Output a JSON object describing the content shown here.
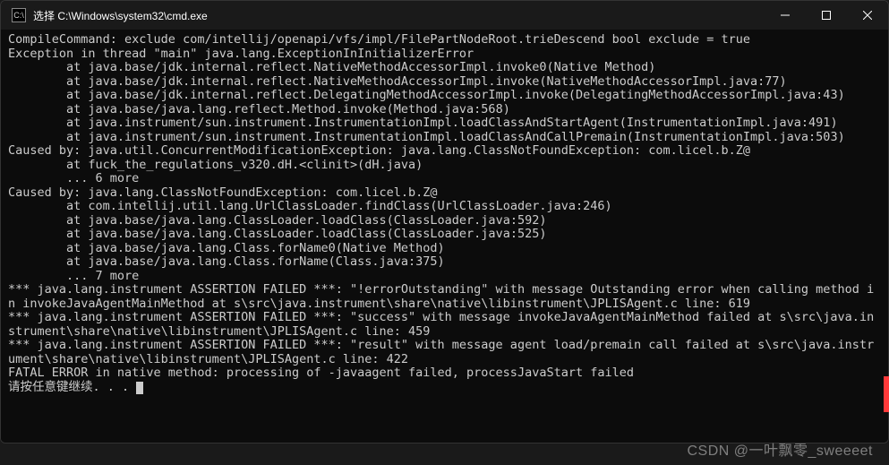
{
  "window": {
    "title": "选择 C:\\Windows\\system32\\cmd.exe",
    "icon_glyph": "C:\\"
  },
  "terminal_lines": [
    "CompileCommand: exclude com/intellij/openapi/vfs/impl/FilePartNodeRoot.trieDescend bool exclude = true",
    "Exception in thread \"main\" java.lang.ExceptionInInitializerError",
    "        at java.base/jdk.internal.reflect.NativeMethodAccessorImpl.invoke0(Native Method)",
    "        at java.base/jdk.internal.reflect.NativeMethodAccessorImpl.invoke(NativeMethodAccessorImpl.java:77)",
    "        at java.base/jdk.internal.reflect.DelegatingMethodAccessorImpl.invoke(DelegatingMethodAccessorImpl.java:43)",
    "        at java.base/java.lang.reflect.Method.invoke(Method.java:568)",
    "        at java.instrument/sun.instrument.InstrumentationImpl.loadClassAndStartAgent(InstrumentationImpl.java:491)",
    "        at java.instrument/sun.instrument.InstrumentationImpl.loadClassAndCallPremain(InstrumentationImpl.java:503)",
    "Caused by: java.util.ConcurrentModificationException: java.lang.ClassNotFoundException: com.licel.b.Z@",
    "        at fuck_the_regulations_v320.dH.<clinit>(dH.java)",
    "        ... 6 more",
    "Caused by: java.lang.ClassNotFoundException: com.licel.b.Z@",
    "        at com.intellij.util.lang.UrlClassLoader.findClass(UrlClassLoader.java:246)",
    "        at java.base/java.lang.ClassLoader.loadClass(ClassLoader.java:592)",
    "        at java.base/java.lang.ClassLoader.loadClass(ClassLoader.java:525)",
    "        at java.base/java.lang.Class.forName0(Native Method)",
    "        at java.base/java.lang.Class.forName(Class.java:375)",
    "        ... 7 more",
    "*** java.lang.instrument ASSERTION FAILED ***: \"!errorOutstanding\" with message Outstanding error when calling method in invokeJavaAgentMainMethod at s\\src\\java.instrument\\share\\native\\libinstrument\\JPLISAgent.c line: 619",
    "*** java.lang.instrument ASSERTION FAILED ***: \"success\" with message invokeJavaAgentMainMethod failed at s\\src\\java.instrument\\share\\native\\libinstrument\\JPLISAgent.c line: 459",
    "*** java.lang.instrument ASSERTION FAILED ***: \"result\" with message agent load/premain call failed at s\\src\\java.instrument\\share\\native\\libinstrument\\JPLISAgent.c line: 422",
    "FATAL ERROR in native method: processing of -javaagent failed, processJavaStart failed"
  ],
  "prompt_line": "请按任意键继续. . . ",
  "watermark": "CSDN @一叶飘零_sweeeet"
}
